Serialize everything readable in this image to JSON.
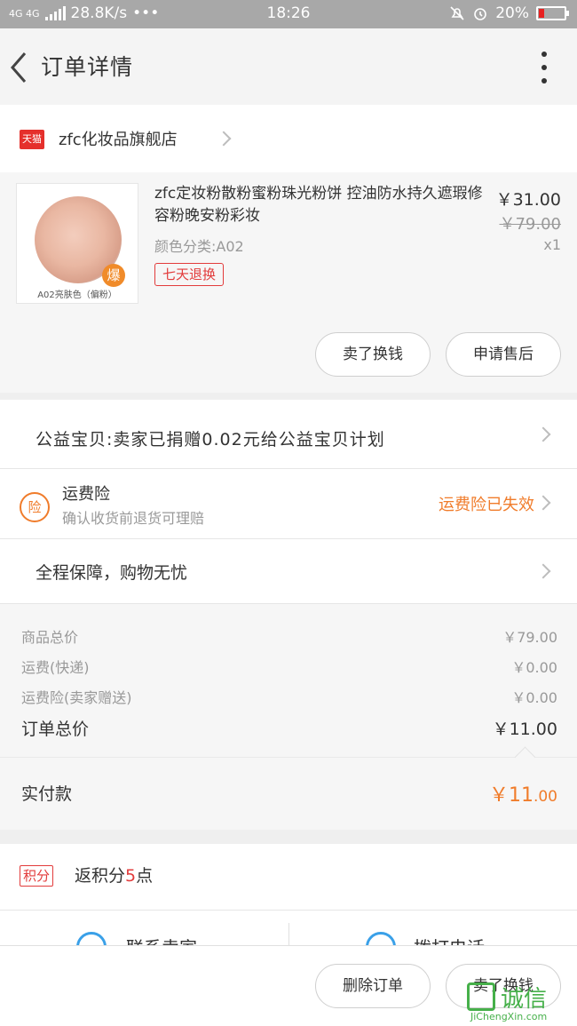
{
  "status_bar": {
    "network": "4G 4G",
    "speed": "28.8K/s",
    "dots": "•••",
    "time": "18:26",
    "battery": "20%",
    "battery_level": 0.2
  },
  "nav": {
    "title": "订单详情"
  },
  "store": {
    "badge": "天猫",
    "name": "zfc化妆品旗舰店"
  },
  "product": {
    "title": "zfc定妆粉散粉蜜粉珠光粉饼 控油防水持久遮瑕修容粉晚安粉彩妆",
    "attr": "颜色分类:A02",
    "tag": "七天退换",
    "price": "￥31.00",
    "old_price": "￥79.00",
    "qty": "x1",
    "image_badge": "爆",
    "image_caption": "A02亮肤色（偏粉）",
    "btn_sell": "卖了换钱",
    "btn_aftersale": "申请售后"
  },
  "charity": {
    "text": "公益宝贝:卖家已捐赠0.02元给公益宝贝计划"
  },
  "insurance": {
    "badge": "险",
    "title": "运费险",
    "subtitle": "确认收货前退货可理赔",
    "status": "运费险已失效"
  },
  "guarantee": {
    "text": "全程保障，购物无忧"
  },
  "summary": {
    "goods_label": "商品总价",
    "goods_value": "￥79.00",
    "ship_label": "运费(快递)",
    "ship_value": "￥0.00",
    "ins_label": "运费险(卖家赠送)",
    "ins_value": "￥0.00",
    "total_label": "订单总价",
    "total_value": "￥11.00"
  },
  "paid": {
    "label": "实付款",
    "amount_main": "￥11",
    "amount_dec": ".00"
  },
  "points": {
    "badge": "积分",
    "prefix": "返积分",
    "num": "5",
    "suffix": "点"
  },
  "contact": {
    "seller": "联系卖家",
    "phone": "拨打电话"
  },
  "bottom": {
    "delete": "删除订单",
    "sell": "卖了换钱"
  },
  "watermark": {
    "cn": "诚信",
    "en": "JiChengXin.com"
  },
  "colors": {
    "accent_orange": "#f07c2b",
    "tmall_red": "#e5302c",
    "tag_red": "#e23b3b"
  }
}
